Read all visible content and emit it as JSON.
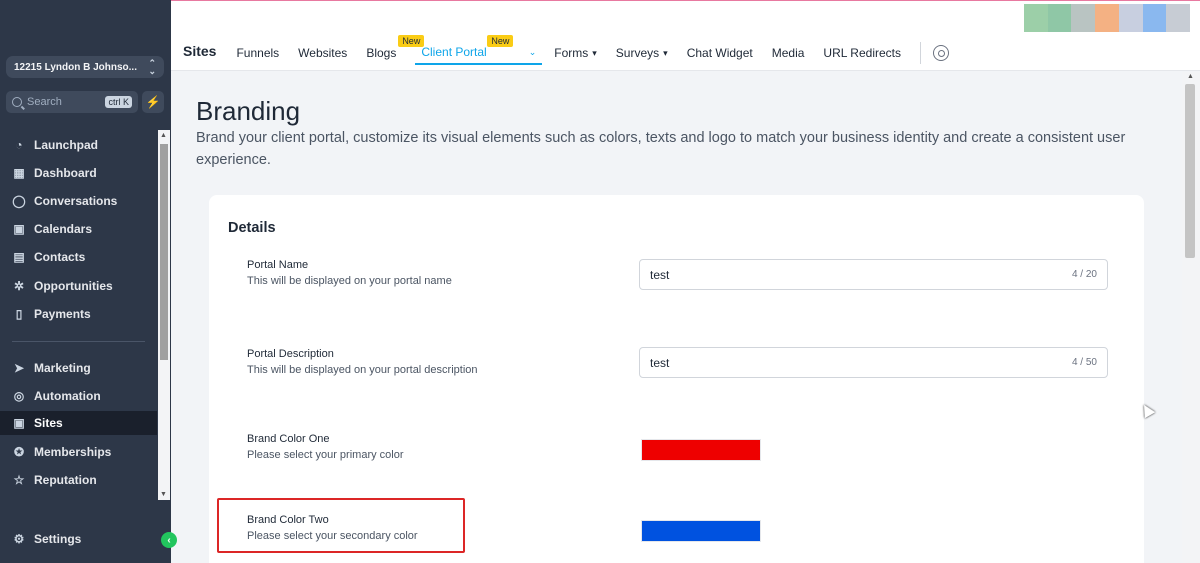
{
  "sidebar": {
    "account": "12215 Lyndon B Johnso...",
    "search": {
      "placeholder": "Search",
      "shortcut": "ctrl K"
    },
    "items": [
      {
        "label": "Launchpad",
        "icon": "rocket-icon"
      },
      {
        "label": "Dashboard",
        "icon": "grid-icon"
      },
      {
        "label": "Conversations",
        "icon": "chat-icon"
      },
      {
        "label": "Calendars",
        "icon": "calendar-icon"
      },
      {
        "label": "Contacts",
        "icon": "contacts-icon"
      },
      {
        "label": "Opportunities",
        "icon": "network-icon"
      },
      {
        "label": "Payments",
        "icon": "receipt-icon"
      },
      {
        "label": "Marketing",
        "icon": "send-icon"
      },
      {
        "label": "Automation",
        "icon": "automation-icon"
      },
      {
        "label": "Sites",
        "icon": "sites-icon"
      },
      {
        "label": "Memberships",
        "icon": "badge-icon"
      },
      {
        "label": "Reputation",
        "icon": "star-icon"
      }
    ],
    "settings": "Settings",
    "active": "Sites"
  },
  "topnav": {
    "title": "Sites",
    "tabs": [
      {
        "label": "Funnels"
      },
      {
        "label": "Websites"
      },
      {
        "label": "Blogs",
        "badge": "New"
      },
      {
        "label": "Client Portal",
        "badge": "New",
        "active": true
      },
      {
        "label": "Forms",
        "dropdown": true
      },
      {
        "label": "Surveys",
        "dropdown": true
      },
      {
        "label": "Chat Widget"
      },
      {
        "label": "Media"
      },
      {
        "label": "URL Redirects"
      }
    ]
  },
  "main": {
    "title": "Branding",
    "description": "Brand your client portal, customize its visual elements such as colors, texts and logo to match your business identity and create a consistent user experience.",
    "card": {
      "title": "Details",
      "fields": [
        {
          "label": "Portal Name",
          "help": "This will be displayed on your portal name",
          "value": "test",
          "count": "4 / 20"
        },
        {
          "label": "Portal Description",
          "help": "This will be displayed on your portal description",
          "value": "test",
          "count": "4 / 50"
        },
        {
          "label": "Brand Color One",
          "help": "Please select your primary color",
          "color": "#ee0000"
        },
        {
          "label": "Brand Color Two",
          "help": "Please select your secondary color",
          "color": "#0052e0"
        }
      ]
    }
  },
  "colors": {
    "accent": "#0ea5e9",
    "sidebar": "#2d3748",
    "highlight": "#dc2626",
    "badge": "#facc15"
  }
}
